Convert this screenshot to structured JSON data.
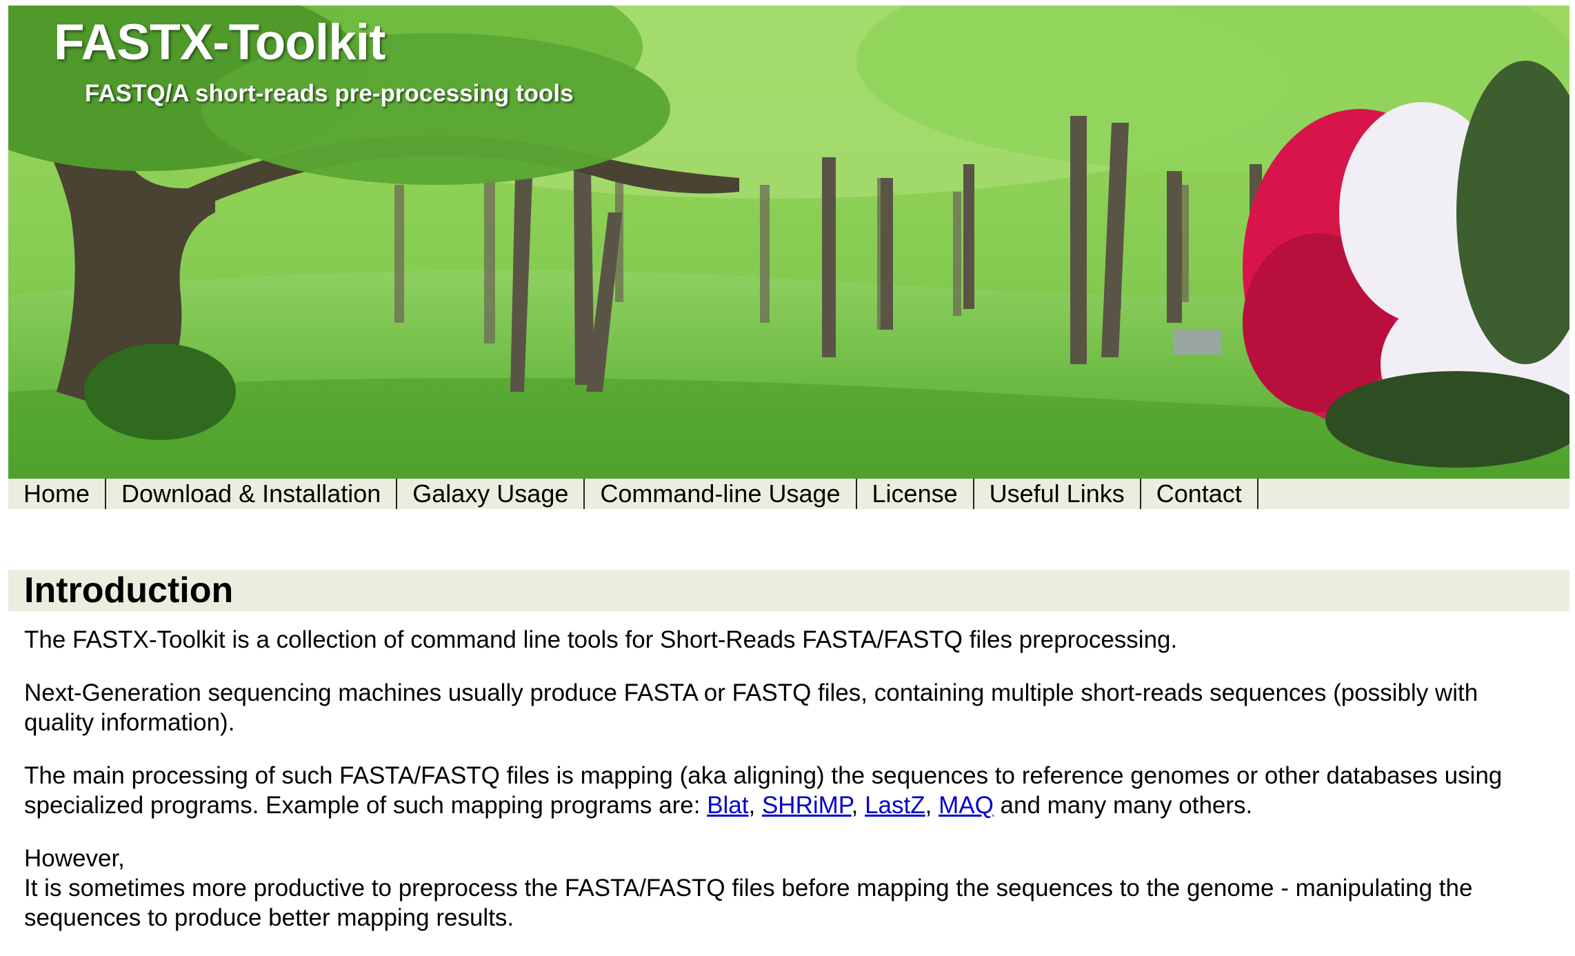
{
  "header": {
    "title": "FASTX-Toolkit",
    "subtitle": "FASTQ/A short-reads pre-processing tools"
  },
  "nav": {
    "items": [
      "Home",
      "Download & Installation",
      "Galaxy Usage",
      "Command-line Usage",
      "License",
      "Useful Links",
      "Contact"
    ]
  },
  "section": {
    "heading": "Introduction",
    "p1": "The FASTX-Toolkit is a collection of command line tools for Short-Reads FASTA/FASTQ files preprocessing.",
    "p2": "Next-Generation sequencing machines usually produce FASTA or FASTQ files, containing multiple short-reads sequences (possibly with quality information).",
    "p3_before": "The main processing of such FASTA/FASTQ files is mapping (aka aligning) the sequences to reference genomes or other databases using specialized programs. Example of such mapping programs are: ",
    "links": [
      "Blat",
      "SHRiMP",
      "LastZ",
      "MAQ"
    ],
    "sep": ", ",
    "p3_after": " and many many others.",
    "p4_line1": "However,",
    "p4_line2": "It is sometimes more productive to preprocess the FASTA/FASTQ files before mapping the sequences to the genome - manipulating the sequences to produce better mapping results."
  },
  "colors": {
    "nav_bg": "#ecedde",
    "link": "#0000cc",
    "grass": "#6cc03a",
    "foliage": "#7fcf48",
    "azalea_red": "#d8154a",
    "azalea_white": "#f2eef6"
  },
  "icons": {
    "banner": "park-landscape-photo"
  }
}
